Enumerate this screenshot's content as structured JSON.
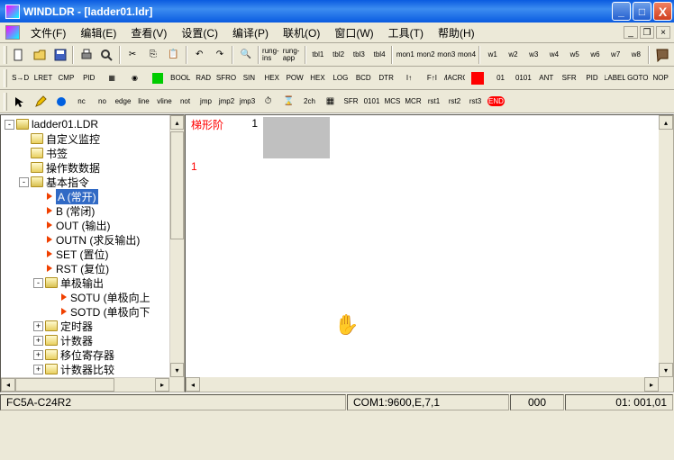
{
  "title": "WINDLDR - [ladder01.ldr]",
  "menus": [
    "文件(F)",
    "编辑(E)",
    "查看(V)",
    "设置(C)",
    "编译(P)",
    "联机(O)",
    "窗口(W)",
    "工具(T)",
    "帮助(H)"
  ],
  "tree": {
    "root": "ladder01.LDR",
    "items": [
      {
        "lvl": 1,
        "exp": "",
        "icon": "fold",
        "label": "自定义监控"
      },
      {
        "lvl": 1,
        "exp": "",
        "icon": "fold",
        "label": "书签"
      },
      {
        "lvl": 1,
        "exp": "",
        "icon": "fold",
        "label": "操作数数据"
      },
      {
        "lvl": 1,
        "exp": "-",
        "icon": "fold-open",
        "label": "基本指令"
      },
      {
        "lvl": 2,
        "exp": "",
        "icon": "tri",
        "label": "A (常开)",
        "sel": true
      },
      {
        "lvl": 2,
        "exp": "",
        "icon": "tri",
        "label": "B (常闭)"
      },
      {
        "lvl": 2,
        "exp": "",
        "icon": "tri",
        "label": "OUT (输出)"
      },
      {
        "lvl": 2,
        "exp": "",
        "icon": "tri",
        "label": "OUTN (求反输出)"
      },
      {
        "lvl": 2,
        "exp": "",
        "icon": "tri",
        "label": "SET (置位)"
      },
      {
        "lvl": 2,
        "exp": "",
        "icon": "tri",
        "label": "RST (复位)"
      },
      {
        "lvl": 2,
        "exp": "-",
        "icon": "fold-open",
        "label": "单极输出"
      },
      {
        "lvl": 3,
        "exp": "",
        "icon": "tri",
        "label": "SOTU (单极向上"
      },
      {
        "lvl": 3,
        "exp": "",
        "icon": "tri",
        "label": "SOTD (单极向下"
      },
      {
        "lvl": 2,
        "exp": "+",
        "icon": "fold",
        "label": "定时器"
      },
      {
        "lvl": 2,
        "exp": "+",
        "icon": "fold",
        "label": "计数器"
      },
      {
        "lvl": 2,
        "exp": "+",
        "icon": "fold",
        "label": "移位寄存器"
      },
      {
        "lvl": 2,
        "exp": "+",
        "icon": "fold",
        "label": "计数器比较"
      }
    ]
  },
  "editor": {
    "heading": "梯形阶",
    "rung": "1",
    "index": "1"
  },
  "status": {
    "device": "FC5A-C24R2",
    "comm": "COM1:9600,E,7,1",
    "count": "000",
    "pos": "01: 001,01"
  },
  "tb_row1": [
    "new",
    "open",
    "save",
    "|",
    "print",
    "preview",
    "|",
    "cut",
    "copy",
    "paste",
    "|",
    "undo",
    "redo",
    "|",
    "find",
    "|",
    "rung-ins",
    "rung-app",
    "|",
    "tbl1",
    "tbl2",
    "tbl3",
    "tbl4",
    "|",
    "mon1",
    "mon2",
    "mon3",
    "mon4",
    "|",
    "w1",
    "w2",
    "w3",
    "w4",
    "w5",
    "w6",
    "w7",
    "w8",
    "|",
    "help"
  ],
  "tb_row2": [
    "S→D",
    "LRET",
    "CMP",
    "PID",
    "blk",
    "rnd",
    "grn",
    "BOOL",
    "RAD",
    "SFRO",
    "SIN",
    "HEX",
    "POW",
    "HEX",
    "LOG",
    "BCD",
    "DTR",
    "I↑",
    "F↑I",
    "MACRO",
    "RED",
    "01",
    "0101",
    "ANT",
    "SFR",
    "PID",
    "LABEL",
    "GOTO",
    "NOP"
  ],
  "tb_row3": [
    "arrow",
    "pencil",
    "coil",
    "nc",
    "no",
    "edge",
    "line",
    "vline",
    "not",
    "jmp",
    "jmp2",
    "jmp3",
    "timer",
    "hour",
    "2ch",
    "blk",
    "SFR",
    "0101",
    "MCS",
    "MCR",
    "rst1",
    "rst2",
    "rst3",
    "END"
  ]
}
